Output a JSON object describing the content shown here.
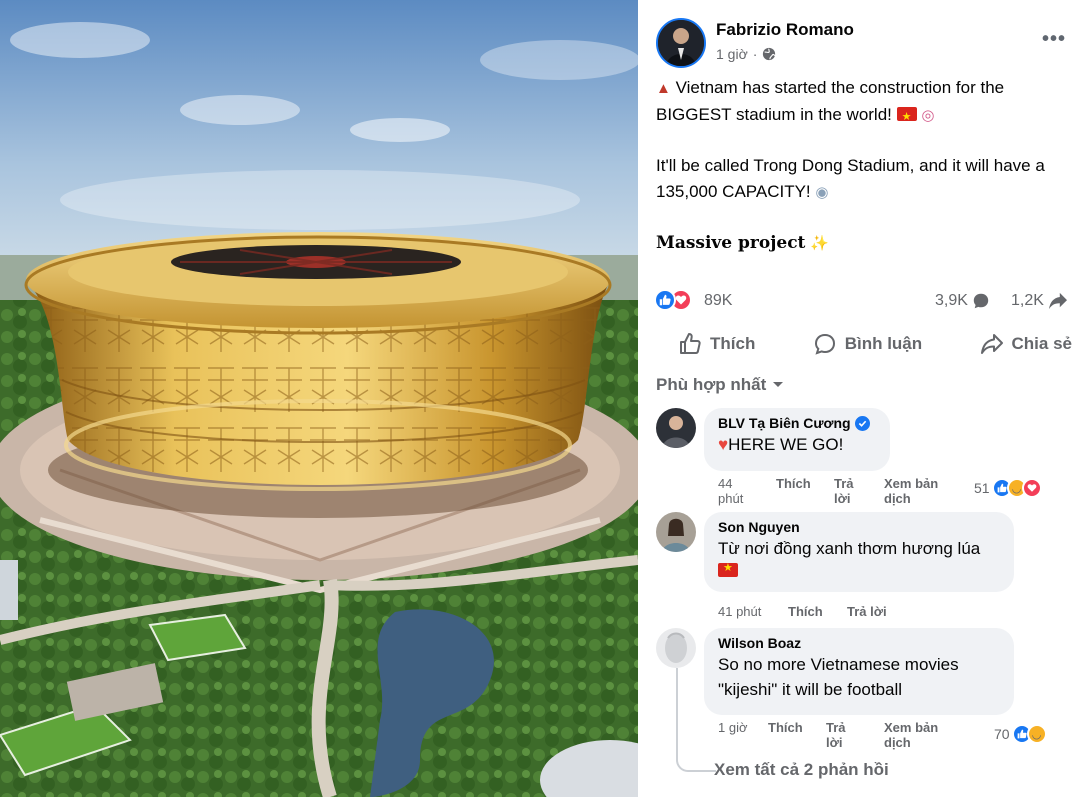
{
  "post": {
    "author": "Fabrizio Romano",
    "time": "1 giờ",
    "privacy_icon": "globe-icon",
    "line1": "Vietnam has started the construction for the BIGGEST stadium in the world!",
    "line2": "It'll be called Trong Dong Stadium, and it will have a 135,000 CAPACITY!",
    "line3": "Massive project",
    "reaction_count": "89K",
    "comment_count": "3,9K",
    "share_count": "1,2K"
  },
  "actions": {
    "like": "Thích",
    "comment": "Bình luận",
    "share": "Chia sẻ"
  },
  "sort_label": "Phù hợp nhất",
  "comments": [
    {
      "name": "BLV Tạ Biên Cương",
      "text": "HERE WE GO!",
      "time": "44 phút",
      "like": "Thích",
      "reply": "Trả lời",
      "translate": "Xem bản dịch",
      "reactions": "51"
    },
    {
      "name": "Son Nguyen",
      "text": "Từ nơi đồng xanh thơm hương lúa",
      "time": "41 phút",
      "like": "Thích",
      "reply": "Trả lời"
    },
    {
      "name": "Wilson Boaz",
      "text_line1": "So no more Vietnamese movies",
      "text_line2": "\"kijeshi\" it will be football",
      "time": "1 giờ",
      "like": "Thích",
      "reply": "Trả lời",
      "translate": "Xem bản dịch",
      "reactions": "70"
    }
  ],
  "view_replies": "Xem tất cả 2 phản hồi",
  "colors": {
    "facebook_blue": "#1877f2",
    "love_red": "#f33e58",
    "muted_text": "#65676b",
    "bubble_bg": "#f0f2f5",
    "gold": "#d4a437"
  }
}
